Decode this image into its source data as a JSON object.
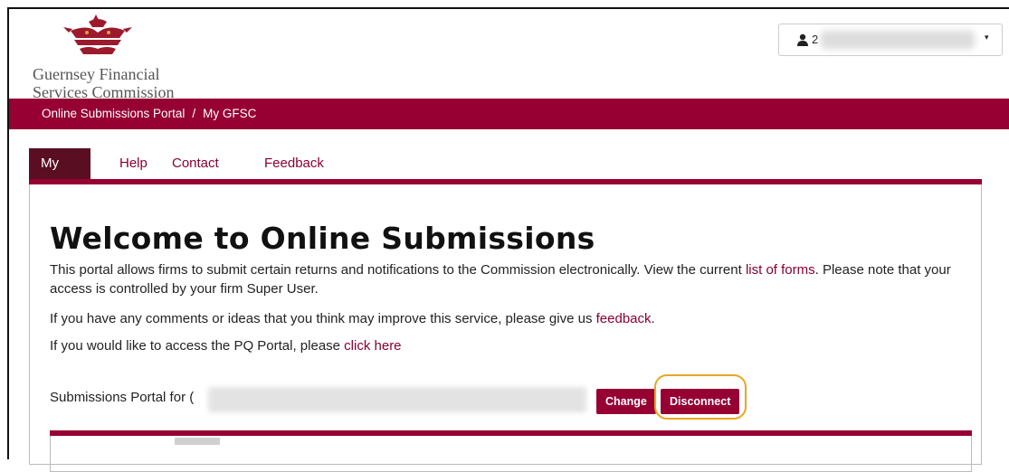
{
  "header": {
    "logo_line1": "Guernsey Financial",
    "logo_line2": "Services Commission",
    "user_menu": {
      "icon": "user-icon",
      "name_visible": "2",
      "caret": "▾"
    }
  },
  "breadcrumb": {
    "items": [
      "Online Submissions Portal",
      "My GFSC"
    ],
    "separator": "/"
  },
  "tabs": [
    {
      "label": "My GFSC",
      "active": true
    },
    {
      "label": "Help",
      "active": false
    },
    {
      "label": "Contact us",
      "active": false
    },
    {
      "label": "Feedback",
      "active": false
    }
  ],
  "main": {
    "title": "Welcome to Online Submissions",
    "para1_pre": "This portal allows firms to submit certain returns and notifications to the Commission electronically. View the current ",
    "para1_link": "list of forms",
    "para1_post": ". Please note that your access is controlled by your firm Super User.",
    "para2_pre": "If you have any comments or ideas that you think may improve this service, please give us ",
    "para2_link": "feedback",
    "para2_post": ".",
    "para3_pre": "If you would like to access the PQ Portal, please ",
    "para3_link": "click here",
    "portal_label": "Submissions Portal for",
    "portal_value_prefix": "(",
    "change_label": "Change",
    "disconnect_label": "Disconnect"
  },
  "colors": {
    "brand": "#960032",
    "tab_active": "#5a0e22",
    "link": "#8b0030",
    "highlight": "#e8a623"
  }
}
